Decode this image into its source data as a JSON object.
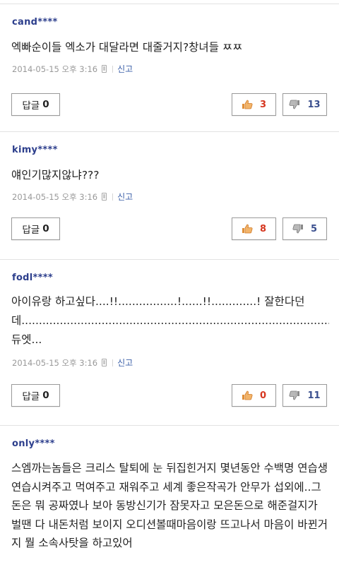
{
  "colors": {
    "author": "#2c3e8c",
    "report_link": "#3b5fa8",
    "like": "#d6361f",
    "dislike": "#3a4f8e"
  },
  "labels": {
    "reply": "답글",
    "report": "신고"
  },
  "comments": [
    {
      "author": "cand****",
      "text": "엑빠순이들 엑소가 대달라면 대줄거지?창녀들 ㅉㅉ",
      "date": "2014-05-15 오후 3:16",
      "replies": "0",
      "likes": "3",
      "dislikes": "13"
    },
    {
      "author": "kimy****",
      "text": "얘인기많지않냐???",
      "date": "2014-05-15 오후 3:16",
      "replies": "0",
      "likes": "8",
      "dislikes": "5"
    },
    {
      "author": "fodl****",
      "text": "아이유랑 하고싶다....!!.................!......!!.............! 잘한다던데.....................................................................................................................................................................................듀엣...",
      "date": "2014-05-15 오후 3:16",
      "replies": "0",
      "likes": "0",
      "dislikes": "11"
    },
    {
      "author": "only****",
      "text": "스엠까는놈들은 크리스 탈퇴에 눈 뒤집힌거지 몇년동안 수백명 연습생 연습시켜주고 먹여주고 재워주고 세계 좋은작곡가 안무가 섭외에..그 돈은 뭐 공짜였나 보아 동방신기가 잠못자고 모은돈으로 해준걸지가 벌땐 다 내돈처럼 보이지 오디션볼때마음이랑 뜨고나서 마음이 바뀐거지 뭘 소속사탓을 하고있어"
    }
  ]
}
